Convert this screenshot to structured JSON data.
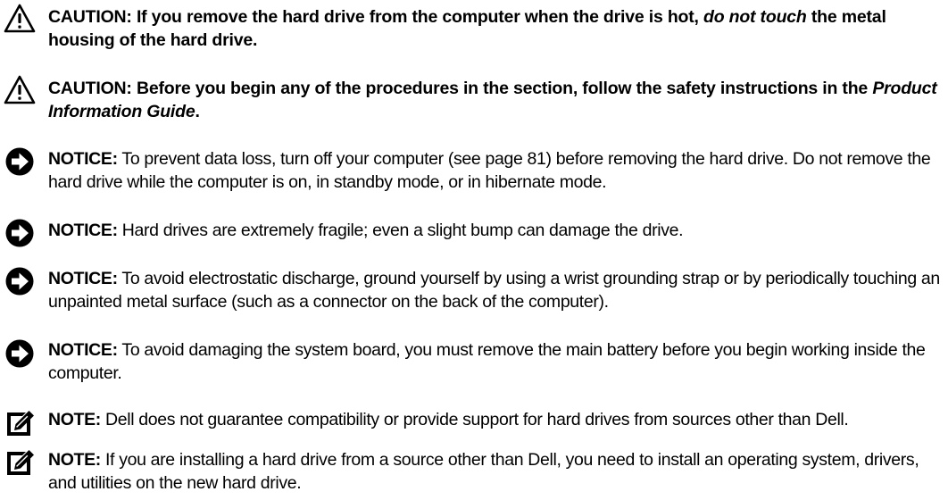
{
  "notes": [
    {
      "kind": "caution",
      "icon": "caution-triangle-icon",
      "label": "CAUTION:",
      "text_before": " If you remove the hard drive from the computer when the drive is hot, ",
      "emphasis": "do not touch",
      "text_after": " the metal housing of the hard drive."
    },
    {
      "kind": "caution",
      "icon": "caution-triangle-icon",
      "label": "CAUTION:",
      "text_before": " Before you begin any of the procedures in the section, follow the safety instructions in the ",
      "emphasis": "Product Information Guide",
      "text_after": "."
    },
    {
      "kind": "notice",
      "icon": "notice-arrow-icon",
      "label": "NOTICE:",
      "text": " To prevent data loss, turn off your computer (see page 81) before removing the hard drive. Do not remove the hard drive while the computer is on, in standby mode, or in hibernate mode."
    },
    {
      "kind": "notice",
      "icon": "notice-arrow-icon",
      "label": "NOTICE:",
      "text": " Hard drives are extremely fragile; even a slight bump can damage the drive."
    },
    {
      "kind": "notice",
      "icon": "notice-arrow-icon",
      "label": "NOTICE:",
      "text": " To avoid electrostatic discharge, ground yourself by using a wrist grounding strap or by periodically touching an unpainted metal surface (such as a connector on the back of the computer)."
    },
    {
      "kind": "notice",
      "icon": "notice-arrow-icon",
      "label": "NOTICE:",
      "text": " To avoid damaging the system board, you must remove the main battery before you begin working inside the computer."
    },
    {
      "kind": "note",
      "icon": "note-pencil-icon",
      "label": "NOTE:",
      "text": " Dell does not guarantee compatibility or provide support for hard drives from sources other than Dell."
    },
    {
      "kind": "note",
      "icon": "note-pencil-icon",
      "label": "NOTE:",
      "text": " If you are installing a hard drive from a source other than Dell, you need to install an operating system, drivers, and utilities on the new hard drive."
    }
  ]
}
